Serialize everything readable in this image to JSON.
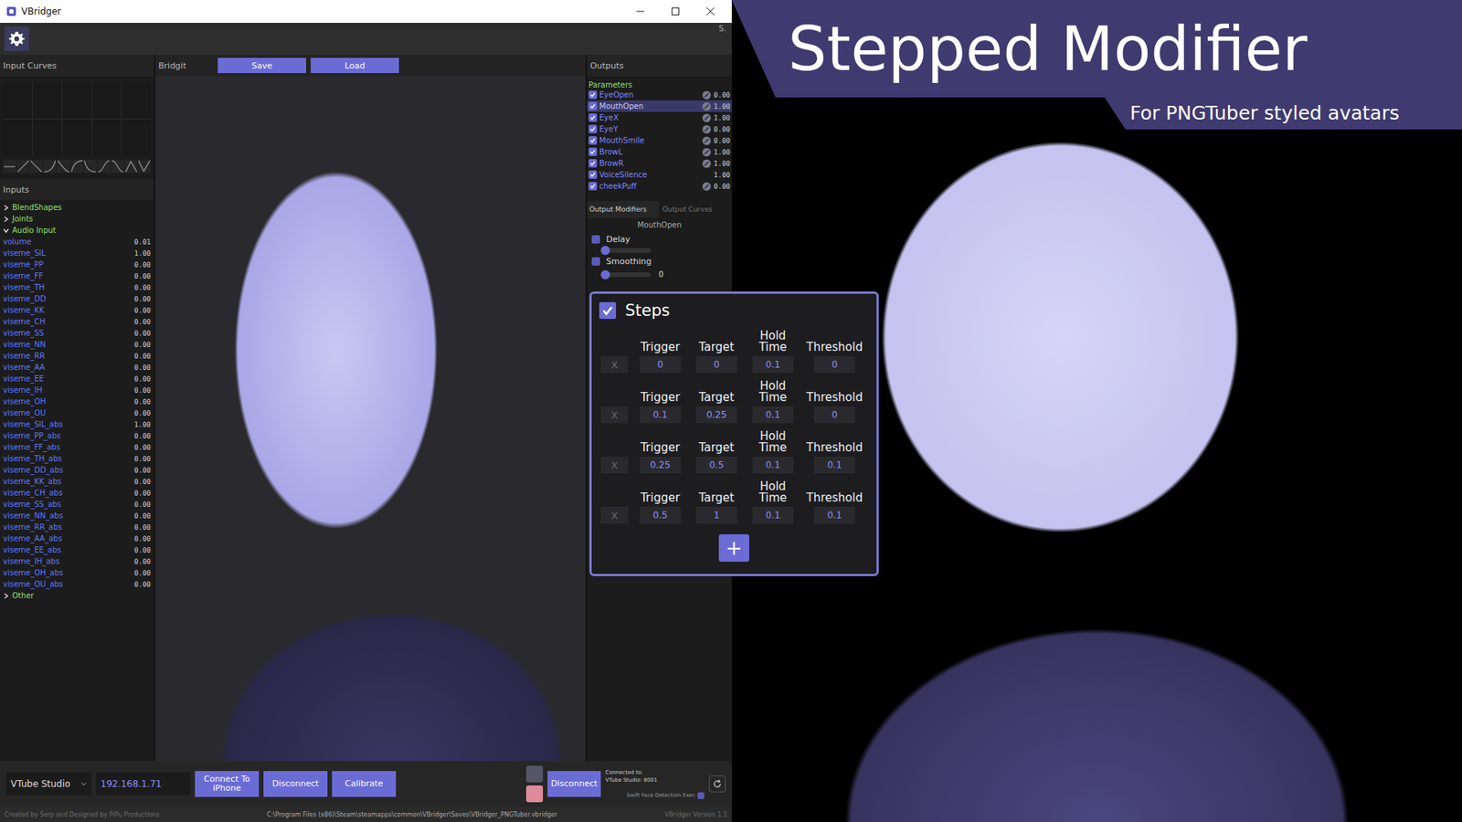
{
  "window": {
    "title": "VBridger",
    "corner_text": "S."
  },
  "input_curves": {
    "title": "Input Curves"
  },
  "bridgit": {
    "title": "Bridgit",
    "buttons": [
      "Save",
      "Load"
    ]
  },
  "inputs": {
    "title": "Inputs",
    "groups": [
      {
        "label": "BlendShapes",
        "expanded": false,
        "items": []
      },
      {
        "label": "Joints",
        "expanded": false,
        "items": []
      },
      {
        "label": "Audio Input",
        "expanded": true,
        "items": [
          {
            "name": "volume",
            "value": "0.01"
          },
          {
            "name": "viseme_SIL",
            "value": "1.00"
          },
          {
            "name": "viseme_PP",
            "value": "0.00"
          },
          {
            "name": "viseme_FF",
            "value": "0.00"
          },
          {
            "name": "viseme_TH",
            "value": "0.00"
          },
          {
            "name": "viseme_DD",
            "value": "0.00"
          },
          {
            "name": "viseme_KK",
            "value": "0.00"
          },
          {
            "name": "viseme_CH",
            "value": "0.00"
          },
          {
            "name": "viseme_SS",
            "value": "0.00"
          },
          {
            "name": "viseme_NN",
            "value": "0.00"
          },
          {
            "name": "viseme_RR",
            "value": "0.00"
          },
          {
            "name": "viseme_AA",
            "value": "0.00"
          },
          {
            "name": "viseme_EE",
            "value": "0.00"
          },
          {
            "name": "viseme_IH",
            "value": "0.00"
          },
          {
            "name": "viseme_OH",
            "value": "0.00"
          },
          {
            "name": "viseme_OU",
            "value": "0.00"
          },
          {
            "name": "viseme_SIL_abs",
            "value": "1.00"
          },
          {
            "name": "viseme_PP_abs",
            "value": "0.00"
          },
          {
            "name": "viseme_FF_abs",
            "value": "0.00"
          },
          {
            "name": "viseme_TH_abs",
            "value": "0.00"
          },
          {
            "name": "viseme_DD_abs",
            "value": "0.00"
          },
          {
            "name": "viseme_KK_abs",
            "value": "0.00"
          },
          {
            "name": "viseme_CH_abs",
            "value": "0.00"
          },
          {
            "name": "viseme_SS_abs",
            "value": "0.00"
          },
          {
            "name": "viseme_NN_abs",
            "value": "0.00"
          },
          {
            "name": "viseme_RR_abs",
            "value": "0.00"
          },
          {
            "name": "viseme_AA_abs",
            "value": "0.00"
          },
          {
            "name": "viseme_EE_abs",
            "value": "0.00"
          },
          {
            "name": "viseme_IH_abs",
            "value": "0.00"
          },
          {
            "name": "viseme_OH_abs",
            "value": "0.00"
          },
          {
            "name": "viseme_OU_abs",
            "value": "0.00"
          }
        ]
      },
      {
        "label": "Other",
        "expanded": false,
        "items": []
      }
    ]
  },
  "outputs": {
    "title": "Outputs",
    "section": "Parameters",
    "parameters": [
      {
        "name": "EyeOpen",
        "checked": true,
        "selected": false,
        "linked": true,
        "value": "0.00"
      },
      {
        "name": "MouthOpen",
        "checked": true,
        "selected": true,
        "linked": true,
        "value": "1.00"
      },
      {
        "name": "EyeX",
        "checked": true,
        "selected": false,
        "linked": true,
        "value": "1.00"
      },
      {
        "name": "EyeY",
        "checked": true,
        "selected": false,
        "linked": true,
        "value": "0.00"
      },
      {
        "name": "MouthSmile",
        "checked": true,
        "selected": false,
        "linked": true,
        "value": "0.00"
      },
      {
        "name": "BrowL",
        "checked": true,
        "selected": false,
        "linked": true,
        "value": "1.00"
      },
      {
        "name": "BrowR",
        "checked": true,
        "selected": false,
        "linked": true,
        "value": "1.00"
      },
      {
        "name": "VoiceSilence",
        "checked": true,
        "selected": false,
        "linked": false,
        "value": "1.00"
      },
      {
        "name": "cheekPuff",
        "checked": true,
        "selected": false,
        "linked": true,
        "value": "0.00"
      }
    ]
  },
  "modifiers": {
    "tabs": [
      {
        "label": "Output Modifiers",
        "selected": true
      },
      {
        "label": "Output Curves",
        "selected": false
      }
    ],
    "parameter": "MouthOpen",
    "delay": {
      "label": "Delay",
      "checked": false,
      "level": 0
    },
    "smoothing": {
      "label": "Smoothing",
      "checked": false,
      "level": 0,
      "reading": "0"
    }
  },
  "steps": {
    "label": "Steps",
    "checked": true,
    "columns": [
      "Trigger",
      "Target",
      "Hold Time",
      "Threshold"
    ],
    "delete_label": "X",
    "add_label": "+",
    "rows": [
      {
        "trigger": "0",
        "target": "0",
        "hold_time": "0.1",
        "threshold": "0"
      },
      {
        "trigger": "0.1",
        "target": "0.25",
        "hold_time": "0.1",
        "threshold": "0"
      },
      {
        "trigger": "0.25",
        "target": "0.5",
        "hold_time": "0.1",
        "threshold": "0.1"
      },
      {
        "trigger": "0.5",
        "target": "1",
        "hold_time": "0.1",
        "threshold": "0.1"
      }
    ]
  },
  "connection": {
    "source": "VTube Studio",
    "ip": "192.168.1.71",
    "buttons": [
      "Connect To iPhone",
      "Disconnect",
      "Calibrate"
    ],
    "vts_button": "Disconnect",
    "status_lines": [
      "Connected to:",
      "VTube Studio: 8001"
    ],
    "face_detection": {
      "label": "Swift Face Detection Exec",
      "checked": false
    }
  },
  "status_bar": {
    "credits": "Created by Serp and Designed by PiPu Productions",
    "path": "C:\\Program Files (x86)\\Steam\\steamapps\\common\\VBridger\\Saves\\VBridger_PNGTuber.vbridger",
    "version": "VBridger Version 1.1"
  },
  "banner": {
    "title": "Stepped Modifier",
    "subtitle": "For PNGTuber styled avatars"
  }
}
